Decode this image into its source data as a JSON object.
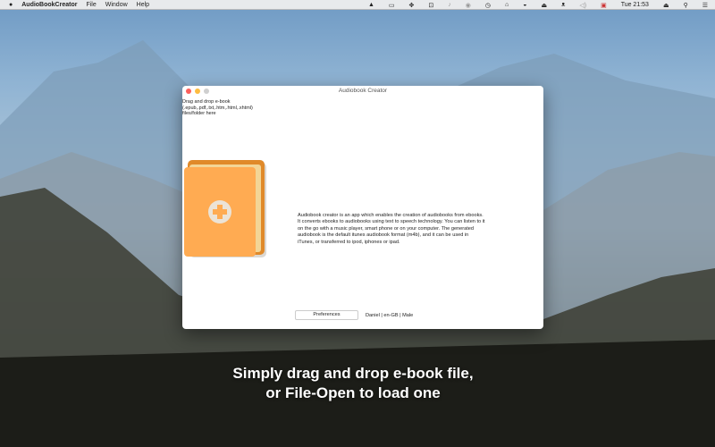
{
  "menubar": {
    "app": "AudioBookCreator",
    "items": [
      "File",
      "Window",
      "Help"
    ],
    "clock": "Tue 21:53"
  },
  "window": {
    "title": "Audiobook Creator",
    "drop_hint": [
      "Drag and drop e-book",
      "(.epub,.pdf,.txt,.htm,.html,.xhtml)",
      "files/folder here"
    ],
    "description": "Audiobook creator is an app which enables the creation of audiobooks from ebooks. It converts ebooks to audiobooks using text to speech technology. You can listen to it on the go with a music player, smart phone or on your computer. The generated audiobook is the default itunes audiobook format (m4b), and it can be used in iTunes, or transferred to ipod, iphones or ipad.",
    "preferences_label": "Preferences",
    "voice": "Daniel | en-GB | Male"
  },
  "caption": [
    "Simply drag and drop e-book file,",
    "or File-Open to load one"
  ],
  "colors": {
    "book_front": "#FFAB52",
    "book_back": "#E08A2A",
    "pages": "#F3D596"
  }
}
